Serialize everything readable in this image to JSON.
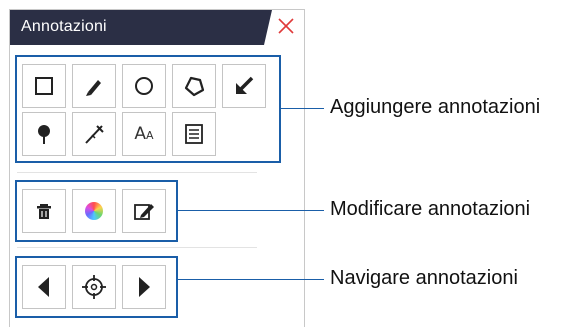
{
  "panel": {
    "title": "Annotazioni",
    "header_color": "#2b2f45",
    "close_color": "#e03a3a"
  },
  "groups": {
    "add": {
      "label": "Aggiungere annotazioni",
      "buttons": [
        "rectangle-icon",
        "pencil-icon",
        "circle-icon",
        "polygon-icon",
        "arrow-icon",
        "pin-icon",
        "measure-icon",
        "text-icon",
        "note-icon"
      ]
    },
    "edit": {
      "label": "Modificare annotazioni",
      "buttons": [
        "trash-icon",
        "color-wheel-icon",
        "edit-icon"
      ]
    },
    "navigate": {
      "label": "Navigare annotazioni",
      "buttons": [
        "previous-icon",
        "locate-icon",
        "next-icon"
      ]
    }
  },
  "text_tool": {
    "big": "A",
    "small": "A"
  },
  "accent_color": "#1a5ea8"
}
